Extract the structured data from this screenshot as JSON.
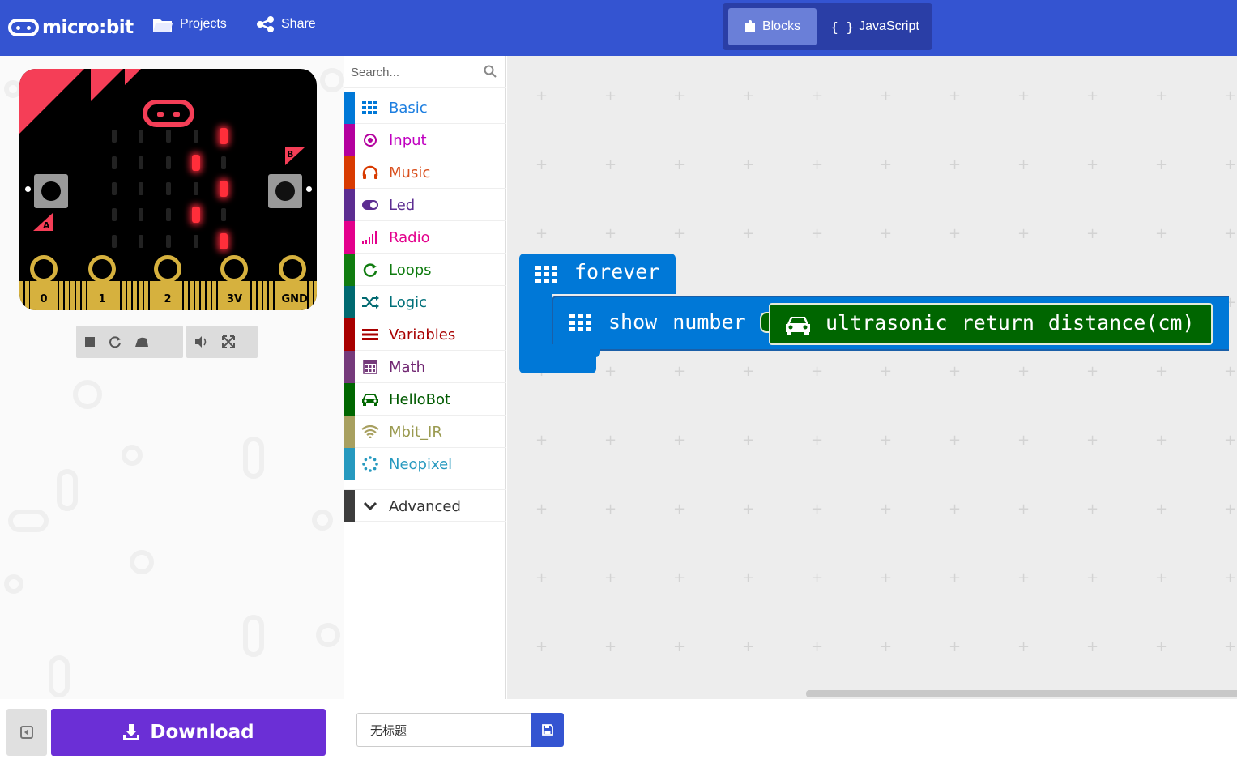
{
  "header": {
    "logo_text": "micro:bit",
    "projects_label": "Projects",
    "share_label": "Share",
    "blocks_tab": "Blocks",
    "javascript_tab": "JavaScript",
    "javascript_brace": "{ }"
  },
  "simulator": {
    "pins": [
      "0",
      "1",
      "2",
      "3V",
      "GND"
    ],
    "button_a": "A",
    "button_b": "B",
    "led_matrix": [
      [
        0,
        0,
        0,
        0,
        1
      ],
      [
        0,
        0,
        0,
        1,
        0
      ],
      [
        0,
        0,
        0,
        0,
        1
      ],
      [
        0,
        0,
        0,
        1,
        0
      ],
      [
        0,
        0,
        0,
        0,
        1
      ]
    ],
    "colors": {
      "board": "#000000",
      "accent": "#f53e57",
      "led_on": "#ff2e3a",
      "pins": "#d6b13e"
    }
  },
  "toolbox": {
    "search_placeholder": "Search...",
    "categories": [
      {
        "label": "Basic",
        "color": "#1E90FF",
        "icon": "grid-icon"
      },
      {
        "label": "Input",
        "color": "#D400D4",
        "icon": "target-icon"
      },
      {
        "label": "Music",
        "color": "#E63022",
        "icon": "headphones-icon"
      },
      {
        "label": "Led",
        "color": "#5C2D91",
        "icon": "toggle-icon"
      },
      {
        "label": "Radio",
        "color": "#E3008C",
        "icon": "signal-bars-icon"
      },
      {
        "label": "Loops",
        "color": "#00AA00",
        "icon": "refresh-icon"
      },
      {
        "label": "Logic",
        "color": "#00A4A6",
        "icon": "shuffle-icon"
      },
      {
        "label": "Variables",
        "color": "#DC143C",
        "icon": "list-icon"
      },
      {
        "label": "Math",
        "color": "#9400D3",
        "icon": "calculator-icon"
      },
      {
        "label": "HelloBot",
        "color": "#006600",
        "icon": "car-icon"
      },
      {
        "label": "Mbit_IR",
        "color": "#A0A060",
        "icon": "wifi-icon"
      },
      {
        "label": "Neopixel",
        "color": "#2699BF",
        "icon": "dotted-circle-icon"
      }
    ],
    "advanced_label": "Advanced"
  },
  "workspace": {
    "forever_label": "forever",
    "show_number_label": "show number",
    "ultrasonic_label": "ultrasonic return distance(cm)",
    "colors": {
      "basic_block": "#0078d7",
      "hellobot_block": "#006600"
    }
  },
  "bottom": {
    "download_label": "Download",
    "project_name": "无标题"
  }
}
